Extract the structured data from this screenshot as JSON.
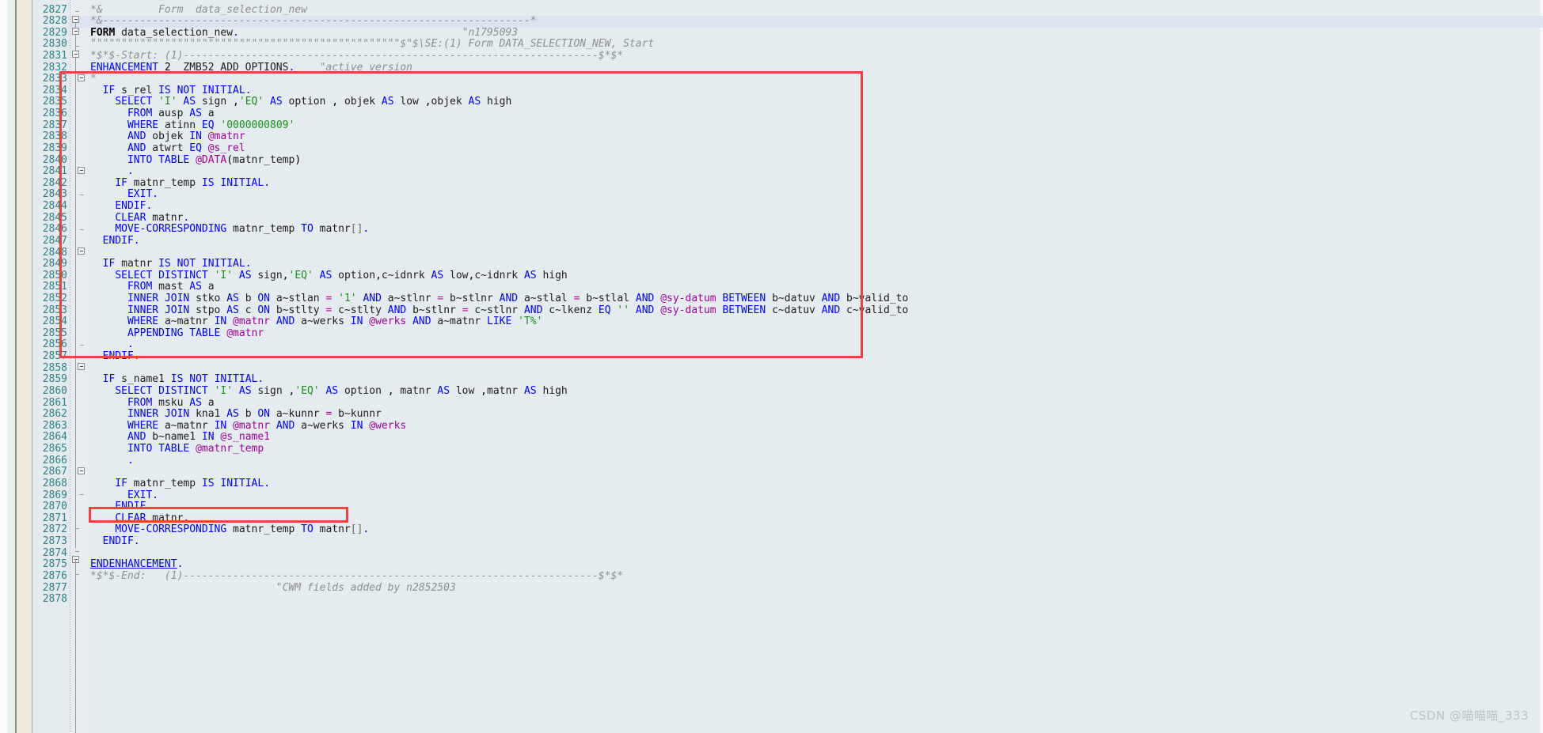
{
  "app": {
    "kind": "abap-code-editor",
    "language": "ABAP",
    "background_color": "#e5ecef",
    "gutter_color": "#e3ebee",
    "line_number_color": "#2e7f86",
    "keyword_color": "#0000ff",
    "literal_color": "#1a8f1a",
    "hostvar_color": "#a0009b",
    "comment_color": "#8a8f96",
    "annotation_color": "#f43f3f",
    "highlighted_line": 2829
  },
  "watermark": {
    "text": "CSDN @喵喵喵_333"
  },
  "annotations": [
    {
      "name": "primary-highlight-box",
      "from_line": 2833,
      "to_line": 2858,
      "label": ""
    },
    {
      "name": "secondary-highlight-box",
      "from_line": 2872,
      "to_line": 2872,
      "label": ""
    }
  ],
  "editor": {
    "first_visible_line": 2827,
    "last_visible_line": 2878,
    "lines": [
      {
        "n": 2827,
        "text": "*&         Form  data_selection_new"
      },
      {
        "n": 2828,
        "text": "*&---------------------------------------------------------------------*"
      },
      {
        "n": 2829,
        "text": "FORM data_selection_new.                                    \"n1795093"
      },
      {
        "n": 2830,
        "text": "\"\"\"\"\"\"\"\"\"\"\"\"\"\"\"\"\"\"\"\"\"\"\"\"\"\"\"\"\"\"\"\"\"\"\"\"\"\"\"\"\"\"\"\"\"\"\"\"\"\"$\"$\\SE:(1) Form DATA_SELECTION_NEW, Start"
      },
      {
        "n": 2831,
        "text": "*$*$-Start: (1)-------------------------------------------------------------------$*$*"
      },
      {
        "n": 2832,
        "text": "ENHANCEMENT 2  ZMB52_ADD_OPTIONS.    \"active version"
      },
      {
        "n": 2833,
        "text": "*"
      },
      {
        "n": 2834,
        "text": "  IF s_rel IS NOT INITIAL."
      },
      {
        "n": 2835,
        "text": "    SELECT 'I' AS sign ,'EQ' AS option , objek AS low ,objek AS high"
      },
      {
        "n": 2836,
        "text": "      FROM ausp AS a"
      },
      {
        "n": 2837,
        "text": "      WHERE atinn EQ '0000000809'"
      },
      {
        "n": 2838,
        "text": "      AND objek IN @matnr"
      },
      {
        "n": 2839,
        "text": "      AND atwrt EQ @s_rel"
      },
      {
        "n": 2840,
        "text": "      INTO TABLE @DATA(matnr_temp)"
      },
      {
        "n": 2841,
        "text": "      ."
      },
      {
        "n": 2842,
        "text": "    IF matnr_temp IS INITIAL."
      },
      {
        "n": 2843,
        "text": "      EXIT."
      },
      {
        "n": 2844,
        "text": "    ENDIF."
      },
      {
        "n": 2845,
        "text": "    CLEAR matnr."
      },
      {
        "n": 2846,
        "text": "    MOVE-CORRESPONDING matnr_temp TO matnr[]."
      },
      {
        "n": 2847,
        "text": "  ENDIF."
      },
      {
        "n": 2848,
        "text": ""
      },
      {
        "n": 2849,
        "text": "  IF matnr IS NOT INITIAL."
      },
      {
        "n": 2850,
        "text": "    SELECT DISTINCT 'I' AS sign,'EQ' AS option,c~idnrk AS low,c~idnrk AS high"
      },
      {
        "n": 2851,
        "text": "      FROM mast AS a"
      },
      {
        "n": 2852,
        "text": "      INNER JOIN stko AS b ON a~stlan = '1' AND a~stlnr = b~stlnr AND a~stlal = b~stlal AND @sy-datum BETWEEN b~datuv AND b~valid_to"
      },
      {
        "n": 2853,
        "text": "      INNER JOIN stpo AS c ON b~stlty = c~stlty AND b~stlnr = c~stlnr AND c~lkenz EQ '' AND @sy-datum BETWEEN c~datuv AND c~valid_to"
      },
      {
        "n": 2854,
        "text": "      WHERE a~matnr IN @matnr AND a~werks IN @werks AND a~matnr LIKE 'T%'"
      },
      {
        "n": 2855,
        "text": "      APPENDING TABLE @matnr"
      },
      {
        "n": 2856,
        "text": "      ."
      },
      {
        "n": 2857,
        "text": "  ENDIF."
      },
      {
        "n": 2858,
        "text": ""
      },
      {
        "n": 2859,
        "text": "  IF s_name1 IS NOT INITIAL."
      },
      {
        "n": 2860,
        "text": "    SELECT DISTINCT 'I' AS sign ,'EQ' AS option , matnr AS low ,matnr AS high"
      },
      {
        "n": 2861,
        "text": "      FROM msku AS a"
      },
      {
        "n": 2862,
        "text": "      INNER JOIN kna1 AS b ON a~kunnr = b~kunnr"
      },
      {
        "n": 2863,
        "text": "      WHERE a~matnr IN @matnr AND a~werks IN @werks"
      },
      {
        "n": 2864,
        "text": "      AND b~name1 IN @s_name1"
      },
      {
        "n": 2865,
        "text": "      INTO TABLE @matnr_temp"
      },
      {
        "n": 2866,
        "text": "      ."
      },
      {
        "n": 2867,
        "text": ""
      },
      {
        "n": 2868,
        "text": "    IF matnr_temp IS INITIAL."
      },
      {
        "n": 2869,
        "text": "      EXIT."
      },
      {
        "n": 2870,
        "text": "    ENDIF."
      },
      {
        "n": 2871,
        "text": "    CLEAR matnr."
      },
      {
        "n": 2872,
        "text": "    MOVE-CORRESPONDING matnr_temp TO matnr[]."
      },
      {
        "n": 2873,
        "text": "  ENDIF."
      },
      {
        "n": 2874,
        "text": ""
      },
      {
        "n": 2875,
        "text": "ENDENHANCEMENT."
      },
      {
        "n": 2876,
        "text": "*$*$-End:   (1)-------------------------------------------------------------------$*$*"
      },
      {
        "n": 2877,
        "text": "                              \"CWM fields added by n2852503"
      },
      {
        "n": 2878,
        "text": ""
      }
    ],
    "tokens": {
      "keywords": [
        "FORM",
        "ENHANCEMENT",
        "IF",
        "IS",
        "NOT",
        "INITIAL",
        "SELECT",
        "DISTINCT",
        "AS",
        "FROM",
        "WHERE",
        "AND",
        "INTO",
        "TABLE",
        "DATA",
        "EXIT",
        "ENDIF",
        "CLEAR",
        "MOVE-CORRESPONDING",
        "TO",
        "INNER",
        "JOIN",
        "ON",
        "BETWEEN",
        "IN",
        "EQ",
        "LIKE",
        "APPENDING",
        "ENDENHANCEMENT"
      ],
      "literals": [
        "'I'",
        "'EQ'",
        "'0000000809'",
        "'1'",
        "''",
        "'T%'"
      ],
      "host_vars": [
        "@matnr",
        "@s_rel",
        "@DATA",
        "@sy-datum",
        "@werks",
        "@matnr_temp",
        "@s_name1"
      ]
    }
  }
}
